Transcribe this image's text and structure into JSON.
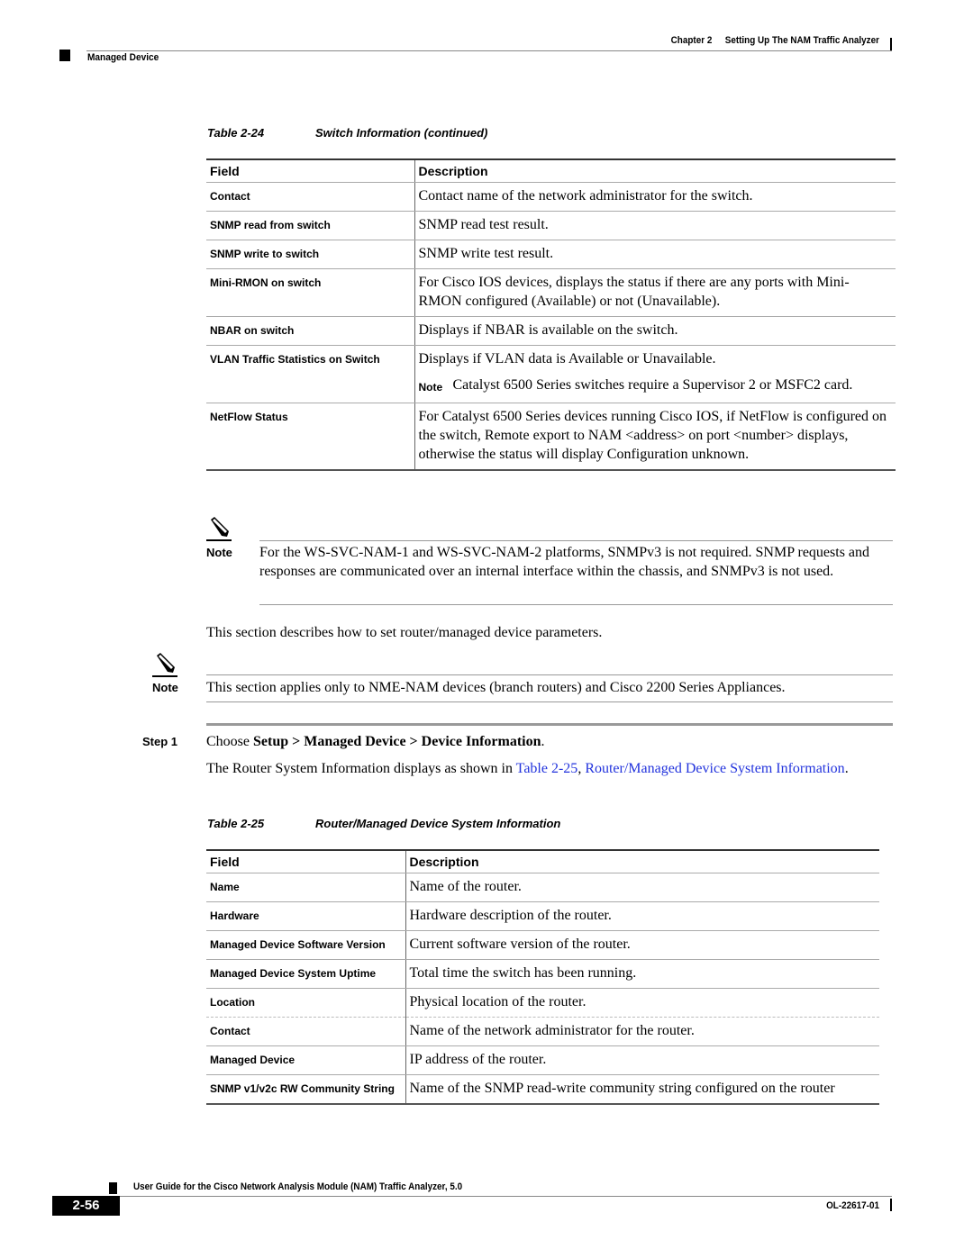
{
  "header": {
    "chapter": "Chapter 2",
    "chapter_title": "Setting Up The NAM Traffic Analyzer",
    "section": "Managed Device"
  },
  "table_24": {
    "caption_number": "Table 2-24",
    "caption_title": "Switch Information (continued)",
    "columns": [
      "Field",
      "Description"
    ],
    "rows": [
      {
        "field": "Contact",
        "description": "Contact name of the network administrator for the switch."
      },
      {
        "field": "SNMP read from switch",
        "description": "SNMP read test result."
      },
      {
        "field": "SNMP write to switch",
        "description": "SNMP write test result."
      },
      {
        "field": "Mini-RMON on switch",
        "description": "For Cisco IOS devices, displays the status if there are any ports with Mini-RMON configured (Available) or not (Unavailable)."
      },
      {
        "field": "NBAR on switch",
        "description": "Displays if NBAR is available on the switch."
      },
      {
        "field": "VLAN Traffic Statistics on Switch",
        "description": "Displays if VLAN data is Available or Unavailable.",
        "note_label": "Note",
        "note_text": "Catalyst 6500 Series switches require a Supervisor 2 or MSFC2 card."
      },
      {
        "field": "NetFlow Status",
        "description": "For Catalyst 6500 Series devices running Cisco IOS, if NetFlow is configured on the switch, Remote export to NAM <address> on port <number> displays, otherwise the status will display Configuration unknown."
      }
    ]
  },
  "note_1": {
    "label": "Note",
    "text": "For the WS-SVC-NAM-1 and WS-SVC-NAM-2 platforms, SNMPv3 is not required. SNMP requests and responses are communicated over an internal interface within the chassis, and SNMPv3 is not used."
  },
  "intro_text": "This section describes how to set router/managed device parameters.",
  "note_2": {
    "label": "Note",
    "text": "This section applies only to NME-NAM devices (branch routers) and Cisco 2200 Series Appliances."
  },
  "step_1": {
    "label": "Step 1",
    "prefix": "Choose ",
    "path": "Setup > Managed Device > Device Information",
    "suffix": ".",
    "follow_prefix": "The Router System Information displays as shown in ",
    "link_table": "Table 2-25",
    "link_sep": ", ",
    "link_title": "Router/Managed Device System Information",
    "follow_suffix": "."
  },
  "table_25": {
    "caption_number": "Table 2-25",
    "caption_title": "Router/Managed Device System Information",
    "columns": [
      "Field",
      "Description"
    ],
    "rows": [
      {
        "field": "Name",
        "description": "Name of the router."
      },
      {
        "field": "Hardware",
        "description": "Hardware description of the router."
      },
      {
        "field": "Managed Device Software Version",
        "description": "Current software version of the router."
      },
      {
        "field": "Managed Device System Uptime",
        "description": "Total time the switch has been running."
      },
      {
        "field": "Location",
        "description": "Physical location of the router."
      },
      {
        "field": "Contact",
        "description": "Name of the network administrator for the router."
      },
      {
        "field": "Managed Device",
        "description": "IP address of the router."
      },
      {
        "field": "SNMP v1/v2c RW Community String",
        "description": "Name of the SNMP read-write community string configured on the router"
      }
    ]
  },
  "footer": {
    "guide_title": "User Guide for the Cisco Network Analysis Module (NAM) Traffic Analyzer, 5.0",
    "page_number": "2-56",
    "doc_number": "OL-22617-01"
  }
}
